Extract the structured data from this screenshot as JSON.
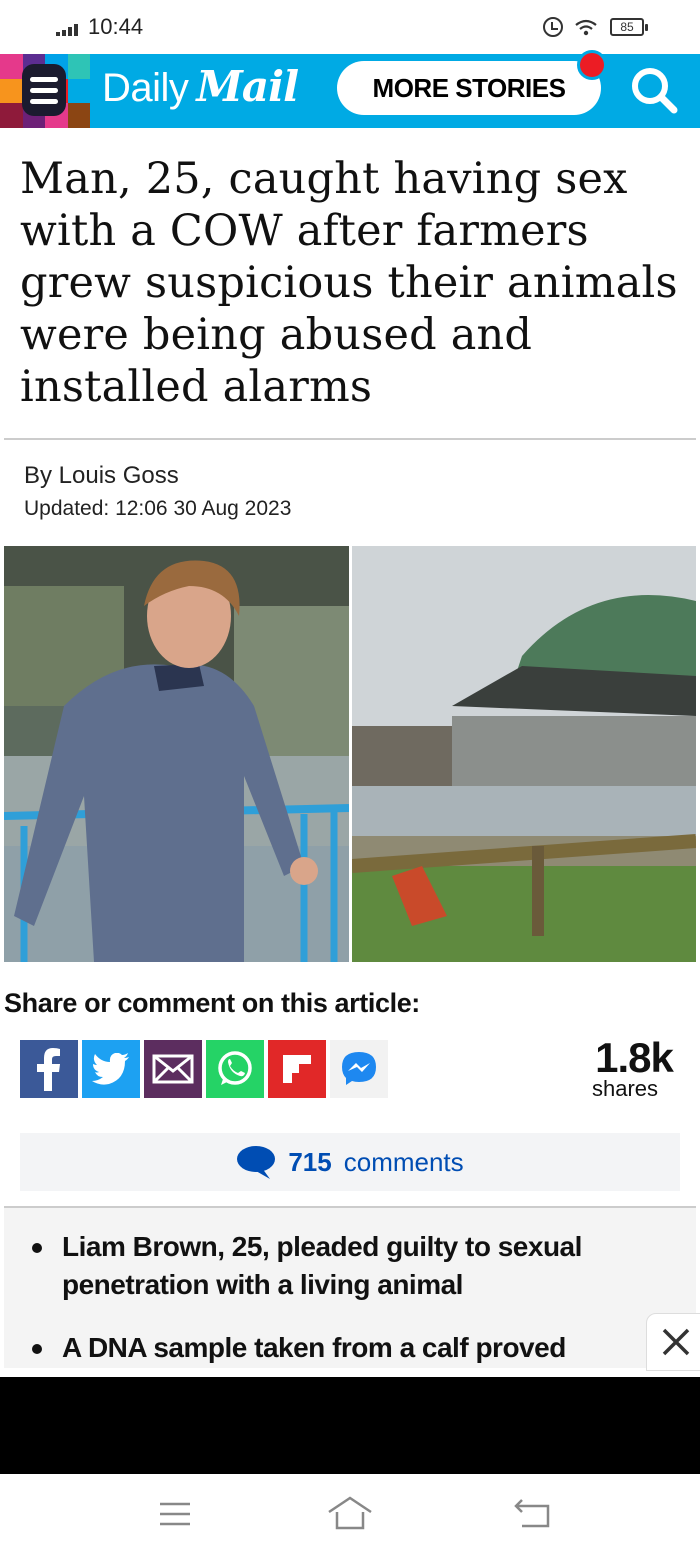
{
  "status_bar": {
    "time": "10:44",
    "battery": "85"
  },
  "header": {
    "logo_daily": "Daily",
    "logo_mail": "Mail",
    "more_stories_label": "MORE STORIES",
    "brand_color": "#00aae4",
    "notification_color": "#ec1c24"
  },
  "article": {
    "headline": "Man, 25, caught having sex with a COW after farmers grew suspicious their animals were being abused and installed alarms",
    "byline": "By Louis Goss",
    "updated": "Updated: 12:06 30 Aug 2023"
  },
  "share": {
    "title": "Share or comment on this article:",
    "buttons": [
      "facebook-icon",
      "twitter-icon",
      "email-icon",
      "whatsapp-icon",
      "flipboard-icon",
      "messenger-icon"
    ],
    "count": "1.8k",
    "count_label": "shares"
  },
  "comments": {
    "count": "715",
    "label": "comments"
  },
  "summary": {
    "bullets": [
      "Liam Brown, 25, pleaded guilty to sexual penetration with a living animal",
      "A DNA sample taken from a calf proved"
    ]
  }
}
